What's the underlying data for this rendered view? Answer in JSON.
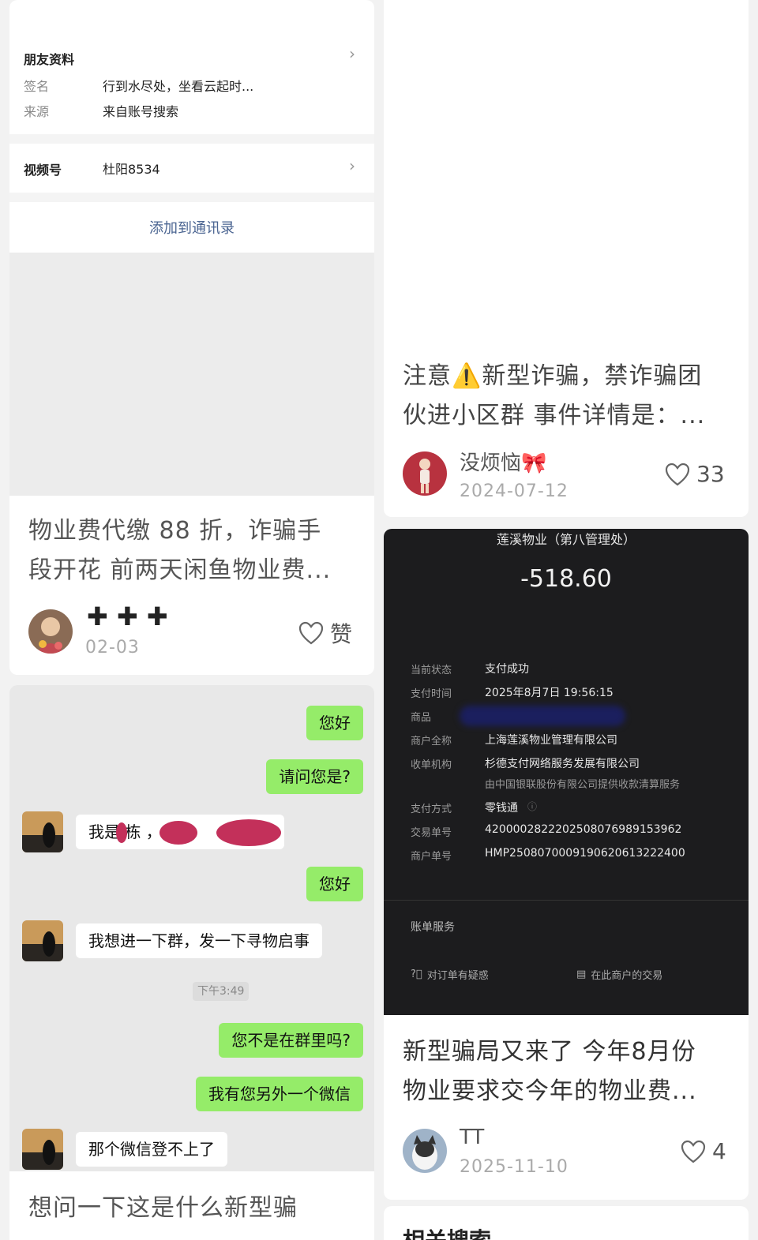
{
  "profile": {
    "section_title": "朋友资料",
    "signature_label": "签名",
    "signature_value": "行到水尽处，坐看云起时...",
    "source_label": "来源",
    "source_value": "来自账号搜索",
    "video_label": "视频号",
    "video_value": "杜阳8534",
    "add_contact": "添加到通讯录"
  },
  "left_post": {
    "title_line1": "物业费代缴 88 折，诈骗手",
    "title_line2": "段开花 前两天闲鱼物业费...",
    "author": "✚ ✚ ✚",
    "date": "02-03",
    "like_label": "赞"
  },
  "chat": {
    "messages": [
      {
        "side": "me",
        "text": "您好"
      },
      {
        "side": "me",
        "text": "请问您是?"
      },
      {
        "side": "other",
        "text": "我是 栋 ，"
      },
      {
        "side": "me",
        "text": "您好"
      },
      {
        "side": "other",
        "text": "我想进一下群，发一下寻物启事"
      },
      {
        "side": "me",
        "text": "您不是在群里吗?"
      },
      {
        "side": "me",
        "text": "我有您另外一个微信"
      },
      {
        "side": "other",
        "text": "那个微信登不上了"
      }
    ],
    "time_chip": "下午3:49"
  },
  "left_post2": {
    "title_line1": "想问一下这是什么新型骗"
  },
  "right_post1": {
    "title_line1": "注意⚠️新型诈骗，禁诈骗团",
    "title_line2": "伙进小区群 事件详情是：...",
    "author": "没烦恼🎀",
    "date": "2024-07-12",
    "likes": "33"
  },
  "receipt": {
    "merchant": "莲溪物业（第八管理处）",
    "amount": "-518.60",
    "rows": [
      {
        "k": "当前状态",
        "v": "支付成功"
      },
      {
        "k": "支付时间",
        "v": "2025年8月7日 19:56:15"
      },
      {
        "k": "商品",
        "v": ""
      },
      {
        "k": "商户全称",
        "v": "上海莲溪物业管理有限公司"
      },
      {
        "k": "收单机构",
        "v": "杉德支付网络服务发展有限公司"
      },
      {
        "k": "支付方式",
        "v": "零钱通"
      },
      {
        "k": "交易单号",
        "v": "4200002822202508076989153962"
      },
      {
        "k": "商户单号",
        "v": "HMP2508070009190620613222400"
      }
    ],
    "acquirer_note": "由中国银联股份有限公司提供收款清算服务",
    "billing_service": "账单服务",
    "action_doubt": "对订单有疑惑",
    "action_merchant": "在此商户的交易"
  },
  "right_post2": {
    "title_line1": "新型骗局又来了 今年8月份",
    "title_line2": "物业要求交今年的物业费...",
    "author": "TT",
    "date": "2025-11-10",
    "likes": "4"
  },
  "related_search": "相关搜索",
  "colors": {
    "link_blue": "#4a6491",
    "wechat_green": "#95ec69",
    "receipt_bg": "#1c1c1e"
  }
}
